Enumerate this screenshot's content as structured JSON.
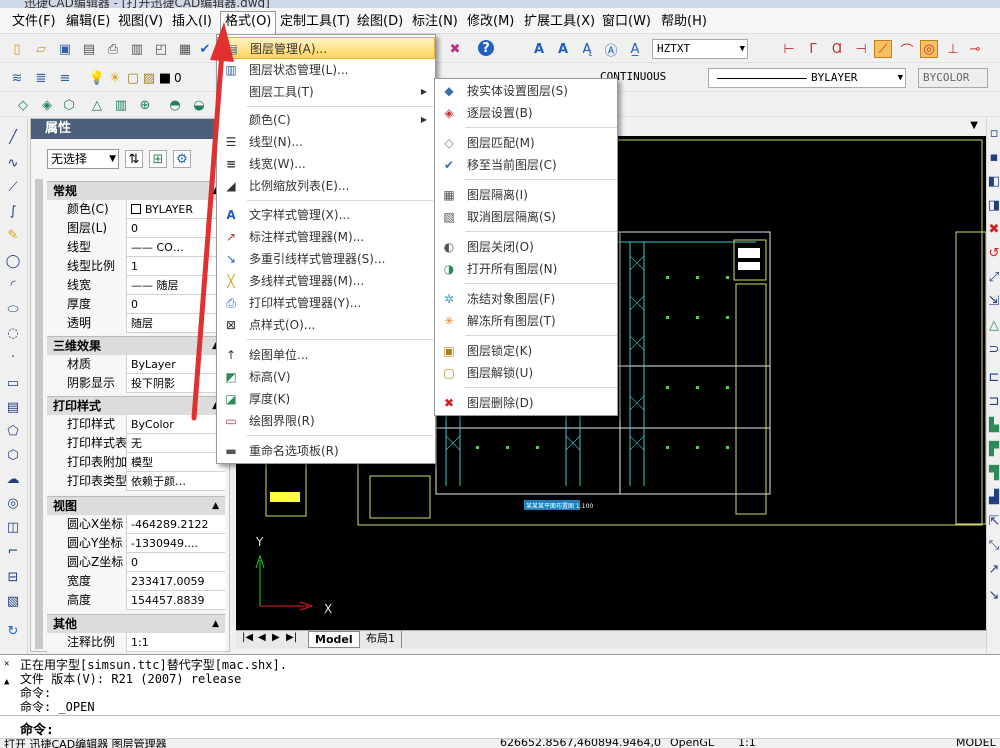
{
  "window": {
    "title": "迅捷CAD编辑器 - [打开迅捷CAD编辑器.dwg]"
  },
  "menubar": [
    {
      "label": "文件(F)"
    },
    {
      "label": "编辑(E)"
    },
    {
      "label": "视图(V)"
    },
    {
      "label": "插入(I)"
    },
    {
      "label": "格式(O)"
    },
    {
      "label": "定制工具(T)"
    },
    {
      "label": "绘图(D)"
    },
    {
      "label": "标注(N)"
    },
    {
      "label": "修改(M)"
    },
    {
      "label": "扩展工具(X)"
    },
    {
      "label": "窗口(W)"
    },
    {
      "label": "帮助(H)"
    }
  ],
  "toolbar": {
    "textstyle": "HZTXT",
    "layer_value": "0",
    "linetype": "CONTINUOUS",
    "lineweight": "BYLAYER",
    "plotstyle": "BYCOLOR"
  },
  "properties": {
    "title": "属性",
    "selection": "无选择",
    "sections": [
      {
        "title": "常规",
        "rows": [
          {
            "k": "颜色(C)",
            "v": "BYLAYER"
          },
          {
            "k": "图层(L)",
            "v": "0"
          },
          {
            "k": "线型",
            "v": "—— CO…"
          },
          {
            "k": "线型比例",
            "v": "1"
          },
          {
            "k": "线宽",
            "v": "—— 随层"
          },
          {
            "k": "厚度",
            "v": "0"
          },
          {
            "k": "透明",
            "v": "随层"
          }
        ]
      },
      {
        "title": "三维效果",
        "rows": [
          {
            "k": "材质",
            "v": "ByLayer"
          },
          {
            "k": "阴影显示",
            "v": "投下阴影"
          }
        ]
      },
      {
        "title": "打印样式",
        "rows": [
          {
            "k": "打印样式",
            "v": "ByColor"
          },
          {
            "k": "打印样式表",
            "v": "无"
          },
          {
            "k": "打印表附加到",
            "v": "模型"
          },
          {
            "k": "打印表类型",
            "v": "依赖于颜…"
          }
        ]
      },
      {
        "title": "视图",
        "rows": [
          {
            "k": "圆心X坐标",
            "v": "-464289.2122"
          },
          {
            "k": "圆心Y坐标",
            "v": "-1330949...."
          },
          {
            "k": "圆心Z坐标",
            "v": "0"
          },
          {
            "k": "宽度",
            "v": "233417.0059"
          },
          {
            "k": "高度",
            "v": "154457.8839"
          }
        ]
      },
      {
        "title": "其他",
        "rows": [
          {
            "k": "注释比例",
            "v": "1:1"
          }
        ]
      }
    ]
  },
  "format_menu": {
    "items": [
      {
        "label": "图层管理(A)...",
        "icon": "layer-manager-icon",
        "glyph": "▤"
      },
      {
        "label": "图层状态管理(L)...",
        "icon": "layer-state-icon",
        "glyph": "▥"
      },
      {
        "label": "图层工具(T)",
        "icon": "",
        "glyph": "",
        "submenu": true
      },
      {
        "label": "颜色(C)",
        "icon": "",
        "glyph": "",
        "submenu": true
      },
      {
        "label": "线型(N)...",
        "icon": "linetype-icon",
        "glyph": "☰"
      },
      {
        "label": "线宽(W)...",
        "icon": "lineweight-icon",
        "glyph": "≡"
      },
      {
        "label": "比例缩放列表(E)...",
        "icon": "scale-list-icon",
        "glyph": "◢"
      },
      {
        "label": "文字样式管理(X)...",
        "icon": "text-style-icon",
        "glyph": "A"
      },
      {
        "label": "标注样式管理器(M)...",
        "icon": "dim-style-icon",
        "glyph": "↗"
      },
      {
        "label": "多重引线样式管理器(S)...",
        "icon": "mleader-style-icon",
        "glyph": "↘"
      },
      {
        "label": "多线样式管理器(M)...",
        "icon": "mline-style-icon",
        "glyph": "╳"
      },
      {
        "label": "打印样式管理器(Y)...",
        "icon": "plot-style-icon",
        "glyph": "⎙"
      },
      {
        "label": "点样式(O)...",
        "icon": "point-style-icon",
        "glyph": "⊠"
      },
      {
        "label": "绘图单位...",
        "icon": "units-icon",
        "glyph": "↑"
      },
      {
        "label": "标高(V)",
        "icon": "elevation-icon",
        "glyph": "◩"
      },
      {
        "label": "厚度(K)",
        "icon": "thickness-icon",
        "glyph": "◪"
      },
      {
        "label": "绘图界限(R)",
        "icon": "limits-icon",
        "glyph": "▭"
      },
      {
        "label": "重命名选项板(R)",
        "icon": "rename-icon",
        "glyph": "▬"
      }
    ]
  },
  "layer_tools_submenu": {
    "items": [
      {
        "label": "按实体设置图层(S)",
        "icon": "layer-by-entity-icon",
        "glyph": "◆",
        "color": "#3a6fb0"
      },
      {
        "label": "逐层设置(B)",
        "icon": "layer-by-layer-icon",
        "glyph": "◈",
        "color": "#c03030"
      },
      {
        "label": "图层匹配(M)",
        "icon": "layer-match-icon",
        "glyph": "◇",
        "color": "#808080"
      },
      {
        "label": "移至当前图层(C)",
        "icon": "move-to-current-icon",
        "glyph": "✔",
        "color": "#3a6fb0"
      },
      {
        "label": "图层隔离(I)",
        "icon": "layer-isolate-icon",
        "glyph": "▦",
        "color": "#555555"
      },
      {
        "label": "取消图层隔离(S)",
        "icon": "layer-unisolate-icon",
        "glyph": "▧",
        "color": "#555555"
      },
      {
        "label": "图层关闭(O)",
        "icon": "layer-off-icon",
        "glyph": "◐",
        "color": "#555555"
      },
      {
        "label": "打开所有图层(N)",
        "icon": "layer-on-icon",
        "glyph": "◑",
        "color": "#2e8b57"
      },
      {
        "label": "冻结对象图层(F)",
        "icon": "layer-freeze-icon",
        "glyph": "✲",
        "color": "#3aa0d0"
      },
      {
        "label": "解冻所有图层(T)",
        "icon": "layer-thaw-icon",
        "glyph": "✳",
        "color": "#e08020"
      },
      {
        "label": "图层锁定(K)",
        "icon": "layer-lock-icon",
        "glyph": "🔒",
        "color": "#b08020"
      },
      {
        "label": "图层解锁(U)",
        "icon": "layer-unlock-icon",
        "glyph": "🔓",
        "color": "#b08020"
      },
      {
        "label": "图层删除(D)",
        "icon": "layer-delete-icon",
        "glyph": "✖",
        "color": "#d02020"
      }
    ]
  },
  "canvas": {
    "x_axis": "X",
    "y_axis": "Y",
    "drawing_title": "某某某平面布置图 1:100"
  },
  "layout_tabs": [
    "Model",
    "布局1"
  ],
  "command": {
    "lines": [
      "正在用字型[simsun.ttc]替代字型[mac.shx].",
      "文件 版本(V): R21 (2007) release",
      "命令:",
      "命令:  _OPEN"
    ],
    "prompt": "命令:"
  },
  "status": {
    "left": "打开 迅捷CAD编辑器 图层管理器",
    "coords": "626652.8567,460894.9464,0",
    "renderer": "OpenGL",
    "scale": "1:1",
    "model": "MODEL"
  }
}
